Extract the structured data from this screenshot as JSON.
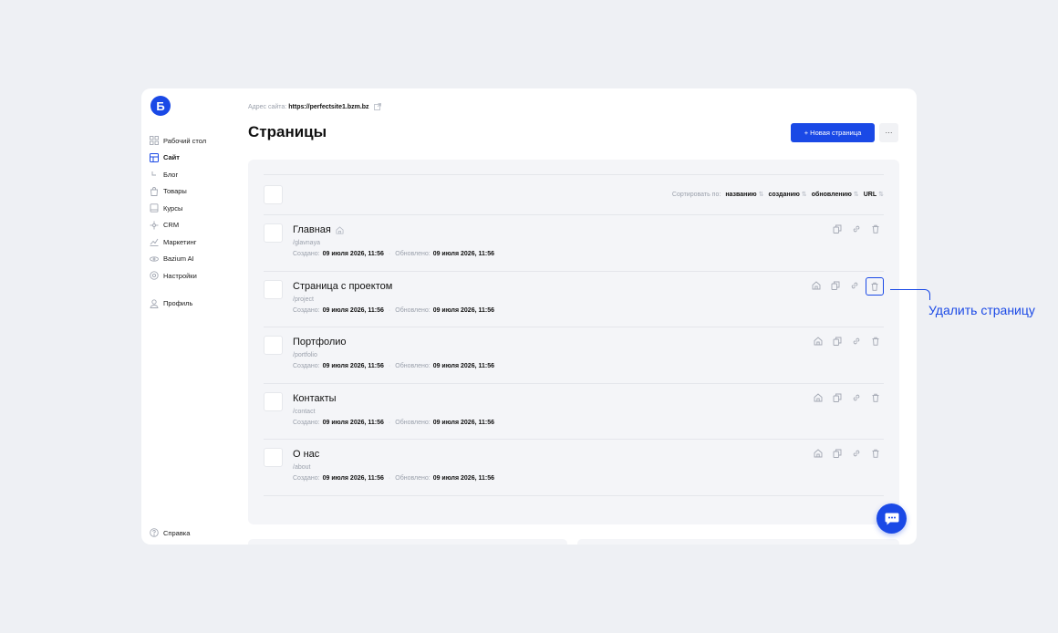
{
  "brand": {
    "logo_letter": "Б",
    "accent": "#1a49e6"
  },
  "sidebar": {
    "items": [
      {
        "label": "Рабочий стол",
        "icon": "grid-icon"
      },
      {
        "label": "Сайт",
        "icon": "layout-icon",
        "active": true
      },
      {
        "label": "Блог",
        "icon": "sub-arrow-icon"
      },
      {
        "label": "Товары",
        "icon": "bag-icon"
      },
      {
        "label": "Курсы",
        "icon": "book-icon"
      },
      {
        "label": "CRM",
        "icon": "crm-icon"
      },
      {
        "label": "Маркетинг",
        "icon": "chart-icon"
      },
      {
        "label": "Bazium AI",
        "icon": "ai-icon"
      },
      {
        "label": "Настройки",
        "icon": "gear-icon"
      },
      {
        "label": "Профиль",
        "icon": "user-icon"
      }
    ],
    "help_label": "Справка"
  },
  "header": {
    "address_label": "Адрес сайта:",
    "address_url": "https://perfectsite1.bzm.bz",
    "title": "Страницы",
    "new_page_label": "+ Новая страница",
    "more_label": "···"
  },
  "sort": {
    "label": "Сортировать по:",
    "options": [
      "названию",
      "созданию",
      "обновлению",
      "URL"
    ]
  },
  "meta_labels": {
    "created": "Создано:",
    "updated": "Обновлено:"
  },
  "pages": [
    {
      "title": "Главная",
      "slug": "/glavnaya",
      "created": "09 июля 2026, 11:56",
      "updated": "09 июля 2026, 11:56",
      "is_home": true
    },
    {
      "title": "Страница с проектом",
      "slug": "/project",
      "created": "09 июля 2026, 11:56",
      "updated": "09 июля 2026, 11:56",
      "is_home": false
    },
    {
      "title": "Портфолио",
      "slug": "/portfolio",
      "created": "09 июля 2026, 11:56",
      "updated": "09 июля 2026, 11:56",
      "is_home": false
    },
    {
      "title": "Контакты",
      "slug": "/contact",
      "created": "09 июля 2026, 11:56",
      "updated": "09 июля 2026, 11:56",
      "is_home": false
    },
    {
      "title": "О нас",
      "slug": "/about",
      "created": "09 июля 2026, 11:56",
      "updated": "09 июля 2026, 11:56",
      "is_home": false
    }
  ],
  "callout": {
    "text": "Удалить страницу"
  }
}
